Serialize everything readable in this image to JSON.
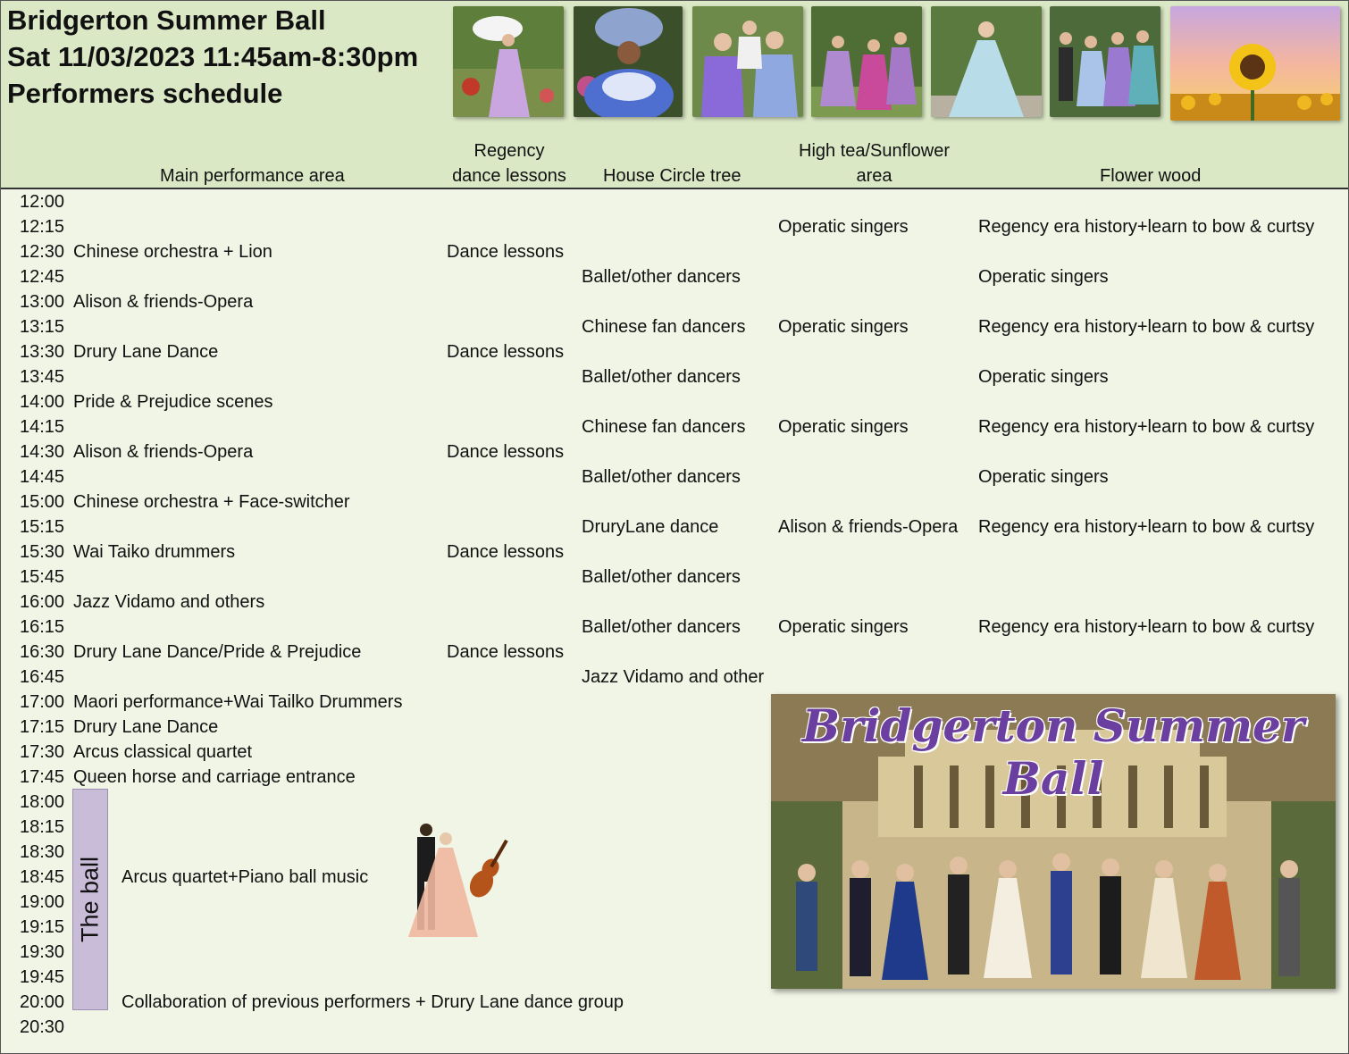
{
  "header": {
    "title": "Bridgerton Summer Ball",
    "date_time": "Sat 11/03/2023 11:45am-8:30pm",
    "subtitle": "Performers schedule"
  },
  "columns": {
    "main": "Main performance area",
    "regency_line1": "Regency",
    "regency_line2": "dance lessons",
    "tree": "House Circle tree",
    "tea_line1": "High tea/Sunflower",
    "tea_line2": "area",
    "flower": "Flower wood"
  },
  "rows": [
    {
      "time": "12:00",
      "main": "",
      "reg": "",
      "tree": "",
      "tea": "",
      "flower": ""
    },
    {
      "time": "12:15",
      "main": "",
      "reg": "",
      "tree": "",
      "tea": "Operatic singers",
      "flower": "Regency era history+learn to bow & curtsy"
    },
    {
      "time": "12:30",
      "main": "Chinese orchestra + Lion",
      "reg": "Dance lessons",
      "tree": "",
      "tea": "",
      "flower": ""
    },
    {
      "time": "12:45",
      "main": "",
      "reg": "",
      "tree": "Ballet/other dancers",
      "tea": "",
      "flower": "Operatic singers"
    },
    {
      "time": "13:00",
      "main": "Alison & friends-Opera",
      "reg": "",
      "tree": "",
      "tea": "",
      "flower": ""
    },
    {
      "time": "13:15",
      "main": "",
      "reg": "",
      "tree": "Chinese fan dancers",
      "tea": "Operatic singers",
      "flower": "Regency era history+learn to bow & curtsy"
    },
    {
      "time": "13:30",
      "main": "Drury Lane Dance",
      "reg": "Dance lessons",
      "tree": "",
      "tea": "",
      "flower": ""
    },
    {
      "time": "13:45",
      "main": "",
      "reg": "",
      "tree": "Ballet/other dancers",
      "tea": "",
      "flower": "Operatic singers"
    },
    {
      "time": "14:00",
      "main": "Pride & Prejudice scenes",
      "reg": "",
      "tree": "",
      "tea": "",
      "flower": ""
    },
    {
      "time": "14:15",
      "main": "",
      "reg": "",
      "tree": "Chinese fan dancers",
      "tea": "Operatic singers",
      "flower": "Regency era history+learn to bow & curtsy"
    },
    {
      "time": "14:30",
      "main": "Alison & friends-Opera",
      "reg": "Dance lessons",
      "tree": "",
      "tea": "",
      "flower": ""
    },
    {
      "time": "14:45",
      "main": "",
      "reg": "",
      "tree": "Ballet/other dancers",
      "tea": "",
      "flower": "Operatic singers"
    },
    {
      "time": "15:00",
      "main": "Chinese orchestra + Face-switcher",
      "reg": "",
      "tree": "",
      "tea": "",
      "flower": ""
    },
    {
      "time": "15:15",
      "main": "",
      "reg": "",
      "tree": "DruryLane dance",
      "tea": "Alison & friends-Opera",
      "flower": "Regency era history+learn to bow & curtsy"
    },
    {
      "time": "15:30",
      "main": "Wai Taiko drummers",
      "reg": "Dance lessons",
      "tree": "",
      "tea": "",
      "flower": ""
    },
    {
      "time": "15:45",
      "main": "",
      "reg": "",
      "tree": "Ballet/other dancers",
      "tea": "",
      "flower": ""
    },
    {
      "time": "16:00",
      "main": "Jazz Vidamo and others",
      "reg": "",
      "tree": "",
      "tea": "",
      "flower": ""
    },
    {
      "time": "16:15",
      "main": "",
      "reg": "",
      "tree": "Ballet/other dancers",
      "tea": "Operatic singers",
      "flower": "Regency era history+learn to bow & curtsy"
    },
    {
      "time": "16:30",
      "main": "Drury Lane Dance/Pride & Prejudice",
      "reg": "Dance lessons",
      "tree": "",
      "tea": "",
      "flower": ""
    },
    {
      "time": "16:45",
      "main": "",
      "reg": "",
      "tree": "Jazz Vidamo and other",
      "tea": "",
      "flower": ""
    },
    {
      "time": "17:00",
      "main": "Maori performance+Wai Tailko Drummers",
      "reg": "",
      "tree": "",
      "tea": "",
      "flower": ""
    },
    {
      "time": "17:15",
      "main": "Drury Lane Dance",
      "reg": "",
      "tree": "",
      "tea": "",
      "flower": ""
    },
    {
      "time": "17:30",
      "main": "Arcus classical quartet",
      "reg": "",
      "tree": "",
      "tea": "",
      "flower": ""
    },
    {
      "time": "17:45",
      "main": "Queen horse and carriage entrance",
      "reg": "",
      "tree": "",
      "tea": "",
      "flower": ""
    },
    {
      "time": "18:00",
      "main": "",
      "reg": "",
      "tree": "",
      "tea": "",
      "flower": ""
    },
    {
      "time": "18:15",
      "main": "",
      "reg": "",
      "tree": "",
      "tea": "",
      "flower": ""
    },
    {
      "time": "18:30",
      "main": "",
      "reg": "",
      "tree": "",
      "tea": "",
      "flower": ""
    },
    {
      "time": "18:45",
      "main": "",
      "reg": "",
      "tree": "",
      "tea": "",
      "flower": ""
    },
    {
      "time": "19:00",
      "main": "",
      "reg": "",
      "tree": "",
      "tea": "",
      "flower": ""
    },
    {
      "time": "19:15",
      "main": "",
      "reg": "",
      "tree": "",
      "tea": "",
      "flower": ""
    },
    {
      "time": "19:30",
      "main": "",
      "reg": "",
      "tree": "",
      "tea": "",
      "flower": ""
    },
    {
      "time": "19:45",
      "main": "",
      "reg": "",
      "tree": "",
      "tea": "",
      "flower": ""
    },
    {
      "time": "20:00",
      "main": "",
      "reg": "",
      "tree": "",
      "tea": "",
      "flower": ""
    },
    {
      "time": "20:30",
      "main": "",
      "reg": "",
      "tree": "",
      "tea": "",
      "flower": ""
    }
  ],
  "ball": {
    "label": "The ball",
    "music": "Arcus quartet+Piano ball music",
    "finale": "Collaboration of previous performers + Drury Lane dance group"
  },
  "poster": {
    "title": "Bridgerton Summer Ball"
  },
  "colors": {
    "header_bg": "#dbe8c6",
    "body_bg": "#f1f5e6",
    "ball_bar": "#c9bcd9",
    "poster_title": "#6b3fa0"
  }
}
